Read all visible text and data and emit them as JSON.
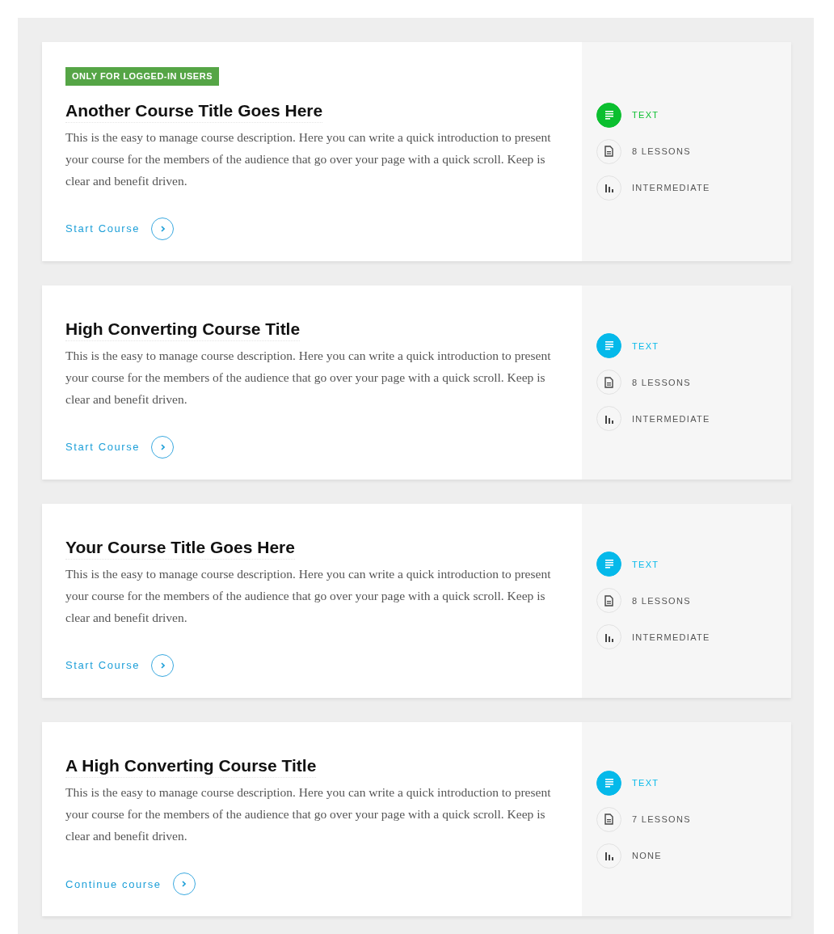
{
  "courses": [
    {
      "badge": "ONLY FOR LOGGED-IN USERS",
      "title": "Another Course Title Goes Here",
      "description": "This is the easy to manage course description. Here you can write a quick introduction to present your course for the members of the audience that go over your page with a quick scroll. Keep is clear and benefit driven.",
      "action": "Start Course",
      "type": "TEXT",
      "color": "#0bbf2f",
      "lessons": "8 LESSONS",
      "level_label": "INTERMEDIATE"
    },
    {
      "title": "High Converting Course Title",
      "description": "This is the easy to manage course description. Here you can write a quick introduction to present your course for the members of the audience that go over your page with a quick scroll. Keep is clear and benefit driven.",
      "action": "Start Course",
      "type": "TEXT",
      "color": "#05b9ea",
      "lessons": "8 LESSONS",
      "level_label": "INTERMEDIATE"
    },
    {
      "title": "Your Course Title Goes Here",
      "description": "This is the easy to manage course description. Here you can write a quick introduction to present your course for the members of the audience that go over your page with a quick scroll. Keep is clear and benefit driven.",
      "action": "Start Course",
      "type": "TEXT",
      "color": "#05b9ea",
      "lessons": "8 LESSONS",
      "level_label": "INTERMEDIATE"
    },
    {
      "title": "A High Converting Course Title",
      "description": "This is the easy to manage course description. Here you can write a quick introduction to present your course for the members of the audience that go over your page with a quick scroll. Keep is clear and benefit driven.",
      "action": "Continue course",
      "type": "TEXT",
      "color": "#05b9ea",
      "lessons": "7 LESSONS",
      "level_label": "NONE"
    }
  ]
}
